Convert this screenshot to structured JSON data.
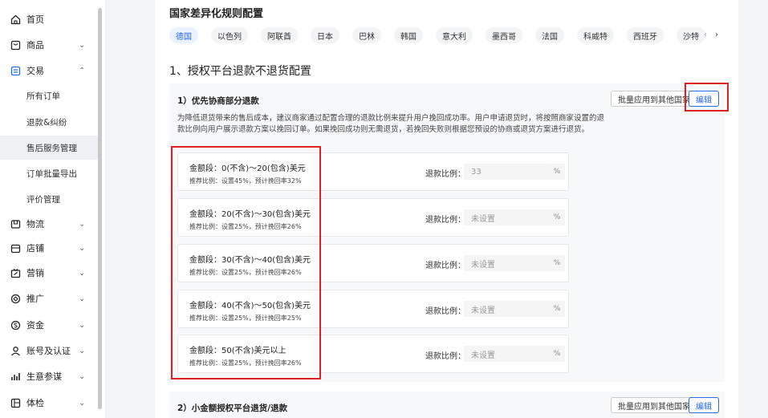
{
  "sidebar": {
    "items": [
      {
        "label": "首页",
        "icon": "home-icon"
      },
      {
        "label": "商品",
        "icon": "goods-icon"
      },
      {
        "label": "交易",
        "icon": "trade-icon"
      },
      {
        "label": "物流",
        "icon": "logistics-icon"
      },
      {
        "label": "店铺",
        "icon": "shop-icon"
      },
      {
        "label": "营销",
        "icon": "marketing-icon"
      },
      {
        "label": "推广",
        "icon": "promotion-icon"
      },
      {
        "label": "资金",
        "icon": "funds-icon"
      },
      {
        "label": "账号及认证",
        "icon": "account-icon"
      },
      {
        "label": "生意参谋",
        "icon": "analytics-icon"
      },
      {
        "label": "体检",
        "icon": "checkup-icon"
      }
    ],
    "subitems": [
      {
        "label": "所有订单"
      },
      {
        "label": "退款&纠纷"
      },
      {
        "label": "售后服务管理"
      },
      {
        "label": "订单批量导出"
      },
      {
        "label": "评价管理"
      }
    ],
    "chev_down": "⌄",
    "chev_up": "⌃"
  },
  "page": {
    "title": "国家差异化规则配置",
    "tabs": [
      "德国",
      "以色列",
      "阿联酋",
      "日本",
      "巴林",
      "韩国",
      "意大利",
      "墨西哥",
      "法国",
      "科威特",
      "西班牙",
      "沙特"
    ],
    "prev": "‹",
    "next": "›",
    "section_title": "1、授权平台退款不退货配置"
  },
  "card1": {
    "heading": "1）优先协商部分退款",
    "apply_btn": "批量应用到其他国家",
    "edit_btn": "编辑",
    "description": "为降低退货带来的售后成本，建议商家通过配置合理的退款比例来提升用户挽回成功率。用户申请退货时，将按照商家设置的退款比例向用户展示退款方案以挽回订单。如果挽回成功则无需退货，若挽回失败则根据您预设的协商或退货方案进行退货。",
    "rows": [
      {
        "amount": "金额段：0(不含)～20(包含)美元",
        "recommend": "推荐比例：设置45%，预计挽回率32%",
        "ratio_label": "退款比例：",
        "value": "33",
        "unit": "%"
      },
      {
        "amount": "金额段：20(不含)～30(包含)美元",
        "recommend": "推荐比例：设置25%，预计挽回率26%",
        "ratio_label": "退款比例：",
        "value": "未设置",
        "unit": "%"
      },
      {
        "amount": "金额段：30(不含)～40(包含)美元",
        "recommend": "推荐比例：设置25%，预计挽回率26%",
        "ratio_label": "退款比例：",
        "value": "未设置",
        "unit": "%"
      },
      {
        "amount": "金额段：40(不含)～50(包含)美元",
        "recommend": "推荐比例：设置25%，预计挽回率25%",
        "ratio_label": "退款比例：",
        "value": "未设置",
        "unit": "%"
      },
      {
        "amount": "金额段：50(不含)美元以上",
        "recommend": "推荐比例：设置25%，预计挽回率26%",
        "ratio_label": "退款比例：",
        "value": "未设置",
        "unit": "%"
      }
    ]
  },
  "card2": {
    "heading": "2）小金额授权平台退货/退款",
    "apply_btn": "批量应用到其他国家",
    "edit_btn": "编辑"
  },
  "colors": {
    "accent": "#2a6ae9",
    "highlight": "#e02020"
  }
}
